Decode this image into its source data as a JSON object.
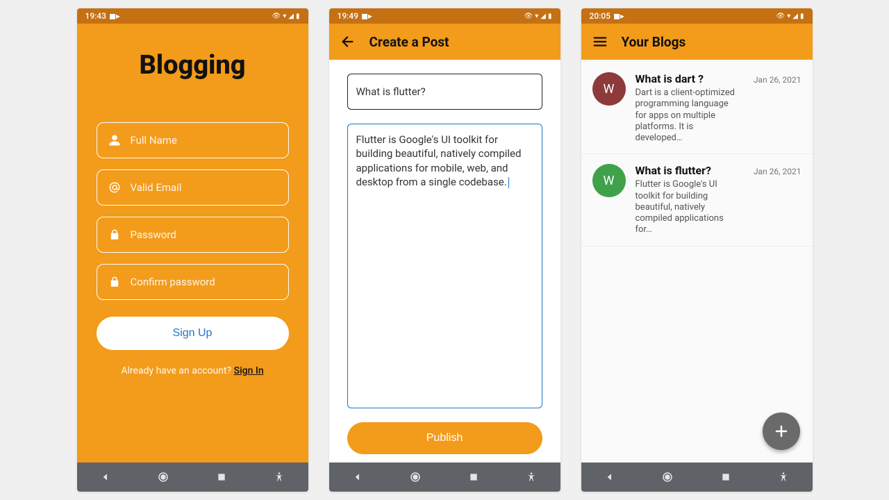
{
  "screen1": {
    "status": {
      "time": "19:43",
      "indicator": "◼▸"
    },
    "title": "Blogging",
    "fields": {
      "fullname": "Full Name",
      "email": "Valid Email",
      "password": "Password",
      "confirm": "Confirm password"
    },
    "signup_label": "Sign Up",
    "already_text": "Already have an account? ",
    "signin_label": "Sign In"
  },
  "screen2": {
    "status": {
      "time": "19:49",
      "indicator": "◼▸"
    },
    "appbar_title": "Create a Post",
    "title_value": "What is flutter?",
    "body_value": "Flutter is Google's UI toolkit for building beautiful, natively compiled applications for mobile, web, and desktop from a single codebase.",
    "publish_label": "Publish"
  },
  "screen3": {
    "status": {
      "time": "20:05",
      "indicator": "◼▸"
    },
    "appbar_title": "Your Blogs",
    "blogs": [
      {
        "avatar_letter": "W",
        "avatar_color": "#8d3a3a",
        "title": "What is dart ?",
        "excerpt": "Dart is a client-optimized programming language for apps on multiple platforms. It is developed…",
        "date": "Jan 26, 2021"
      },
      {
        "avatar_letter": "W",
        "avatar_color": "#3fa24a",
        "title": "What is flutter?",
        "excerpt": "Flutter is Google's UI toolkit for building beautiful, natively compiled applications for…",
        "date": "Jan 26, 2021"
      }
    ]
  }
}
